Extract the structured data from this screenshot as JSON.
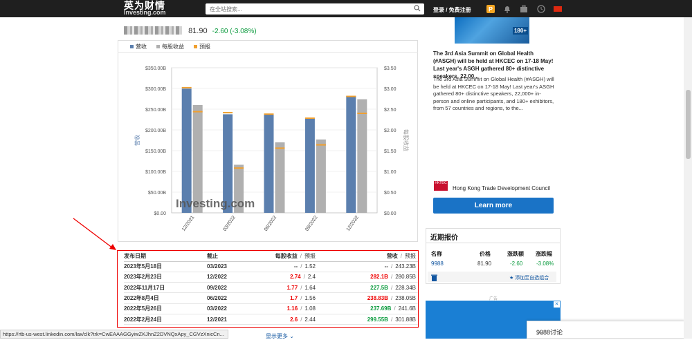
{
  "header": {
    "logo_cn": "英为财情",
    "logo_en": "Investing.com",
    "search_placeholder": "在全站搜索...",
    "login_label": "登录 / 免费注册"
  },
  "stock": {
    "price": "81.90",
    "change": "-2.60 (-3.08%)"
  },
  "legend": [
    {
      "label": "营收",
      "color": "#5b7fae"
    },
    {
      "label": "每股收益",
      "color": "#b0b0b0"
    },
    {
      "label": "预报",
      "color": "#f0a030"
    }
  ],
  "chart_data": {
    "type": "bar",
    "categories": [
      "12/2021",
      "03/2022",
      "06/2022",
      "09/2022",
      "12/2022"
    ],
    "series": [
      {
        "name": "营收",
        "axis": "left",
        "unit": "B",
        "values": [
          299.55,
          237.69,
          238.83,
          227.5,
          282.1
        ],
        "forecast": [
          301.88,
          241.6,
          238.05,
          228.34,
          280.85
        ]
      },
      {
        "name": "每股收益",
        "axis": "right",
        "values": [
          2.6,
          1.16,
          1.7,
          1.77,
          2.74
        ],
        "forecast": [
          2.44,
          1.08,
          1.56,
          1.64,
          2.4
        ]
      }
    ],
    "left_axis": {
      "label": "营收",
      "ticks": [
        "$0.00",
        "$50.00B",
        "$100.00B",
        "$150.00B",
        "$200.00B",
        "$250.00B",
        "$300.00B",
        "$350.00B"
      ],
      "ylim": [
        0,
        350
      ]
    },
    "right_axis": {
      "label": "每股收益",
      "ticks": [
        "$0.00",
        "$0.50",
        "$1.00",
        "$1.50",
        "$2.00",
        "$2.50",
        "$3.00",
        "$3.50"
      ],
      "ylim": [
        0,
        3.5
      ]
    },
    "watermark": "Investing.com"
  },
  "table": {
    "headers": {
      "date": "发布日期",
      "period": "截止",
      "eps": "每股收益",
      "revenue": "营收",
      "forecast": "预报",
      "sep": "/"
    },
    "rows": [
      {
        "date": "2023年5月18日",
        "period": "03/2023",
        "eps": "--",
        "eps_cls": "neu",
        "eps_f": "1.52",
        "rev": "--",
        "rev_cls": "neu",
        "rev_f": "243.23B"
      },
      {
        "date": "2023年2月23日",
        "period": "12/2022",
        "eps": "2.74",
        "eps_cls": "neg",
        "eps_f": "2.4",
        "rev": "282.1B",
        "rev_cls": "neg",
        "rev_f": "280.85B"
      },
      {
        "date": "2022年11月17日",
        "period": "09/2022",
        "eps": "1.77",
        "eps_cls": "neg",
        "eps_f": "1.64",
        "rev": "227.5B",
        "rev_cls": "pos",
        "rev_f": "228.34B"
      },
      {
        "date": "2022年8月4日",
        "period": "06/2022",
        "eps": "1.7",
        "eps_cls": "neg",
        "eps_f": "1.56",
        "rev": "238.83B",
        "rev_cls": "neg",
        "rev_f": "238.05B"
      },
      {
        "date": "2022年5月26日",
        "period": "03/2022",
        "eps": "1.16",
        "eps_cls": "neg",
        "eps_f": "1.08",
        "rev": "237.69B",
        "rev_cls": "pos",
        "rev_f": "241.6B"
      },
      {
        "date": "2022年2月24日",
        "period": "12/2021",
        "eps": "2.6",
        "eps_cls": "neg",
        "eps_f": "2.44",
        "rev": "299.55B",
        "rev_cls": "pos",
        "rev_f": "301.88B"
      }
    ],
    "show_more": "显示更多"
  },
  "status_url": "https://rtb-us-west.linkedin.com/lax/clk?trk=CwEAAAGGyiwZKJhnZ2DVNQxApy_CGVzXnicCn...",
  "ad": {
    "badge": "180+",
    "headline": "The 3rd Asia Summit on Global Health (#ASGH) will be held at HKCEC on 17-18 May! Last year's ASGH gathered 80+ distinctive speakers, 22,00...",
    "body": "The 3rd Asia Summit on Global Health (#ASGH) will be held at HKCEC on 17-18 May! Last year's ASGH gathered 80+ distinctive speakers, 22,000+ in-person and online participants, and 180+ exhibitors, from 57 countries and regions, to the...",
    "org_logo": "HKTDC",
    "org": "Hong Kong Trade Development Council",
    "cta": "Learn more"
  },
  "quotes": {
    "title": "近期报价",
    "headers": [
      "名称",
      "价格",
      "涨跌额",
      "涨跌幅"
    ],
    "row": {
      "name": "9988",
      "price": "81.90",
      "change": "-2.60",
      "pct": "-3.08%"
    },
    "add_watch": "添加至自选组合"
  },
  "ad2_label": "广告",
  "discussion": "9988讨论"
}
